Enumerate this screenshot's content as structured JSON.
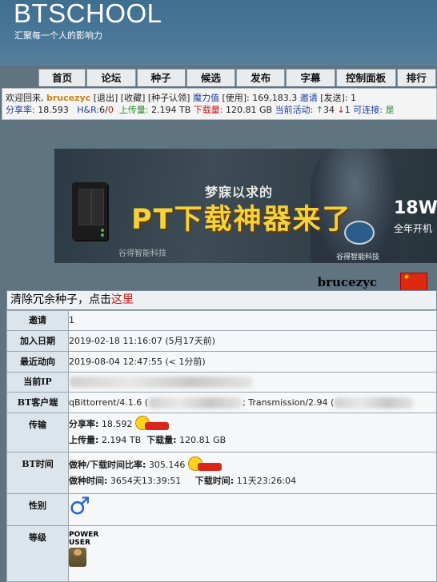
{
  "site": {
    "title": "BTSCHOOL",
    "slogan": "汇聚每一个人的影响力"
  },
  "nav": [
    "首页",
    "论坛",
    "种子",
    "候选",
    "发布",
    "字幕",
    "控制面板",
    "排行"
  ],
  "info_bar": {
    "welcome": "欢迎回来,",
    "username": "brucezyc",
    "links1": "[退出] [收藏] [种子认领]",
    "bonus_label": "魔力值",
    "bonus_rest": "[使用]: 169,183.3",
    "invite_label": "邀请",
    "invite_rest": "[发送]: 1",
    "ratio_label": "分享率:",
    "ratio": "18.593",
    "hr_label": "H&R:",
    "hr_val": "6/",
    "hr_red": "0",
    "up_label": "上传量:",
    "up": "2.194 TB",
    "down_label": "下载量:",
    "down": "120.81 GB",
    "active_label": "当前活动:",
    "active_up": "34",
    "active_down": "1",
    "connect_label": "可连接:",
    "connect": "是"
  },
  "banner": {
    "subtitle": "梦寐以求的",
    "title": "PT下载神器来了",
    "promo_big": "18W",
    "promo_small": "全年开机",
    "brand": "谷得智能科技",
    "brand2": "谷得智能科技"
  },
  "profile": {
    "username": "brucezyc",
    "clean_text": "清除冗余种子，点击",
    "clean_link": "这里",
    "rows": {
      "invite": {
        "label": "邀请",
        "value": "1"
      },
      "join": {
        "label": "加入日期",
        "value": "2019-02-18 11:16:07 (5月17天前)"
      },
      "last": {
        "label": "最近动向",
        "value": "2019-08-04 12:47:55 (< 1分前)"
      },
      "ip": {
        "label": "当前IP"
      },
      "client": {
        "label": "BT客户端",
        "value1": "qBittorrent/4.1.6 (",
        "value2": "; Transmission/2.94 ("
      },
      "transfer": {
        "label": "传输",
        "ratio_label": "分享率:",
        "ratio": "18.592",
        "up_label": "上传量:",
        "up": "2.194 TB",
        "down_label": "下载量:",
        "down": "120.81 GB"
      },
      "bttime": {
        "label": "BT时间",
        "ratio_label": "做种/下载时间比率:",
        "ratio": "305.146",
        "seed_label": "做种时间:",
        "seed": "3654天13:39:51",
        "dl_label": "下载时间:",
        "dl": "11天23:26:04"
      },
      "gender": {
        "label": "性别",
        "value": "♂"
      },
      "rank": {
        "label": "等级",
        "line1": "POWER",
        "line2": "USER"
      }
    }
  }
}
